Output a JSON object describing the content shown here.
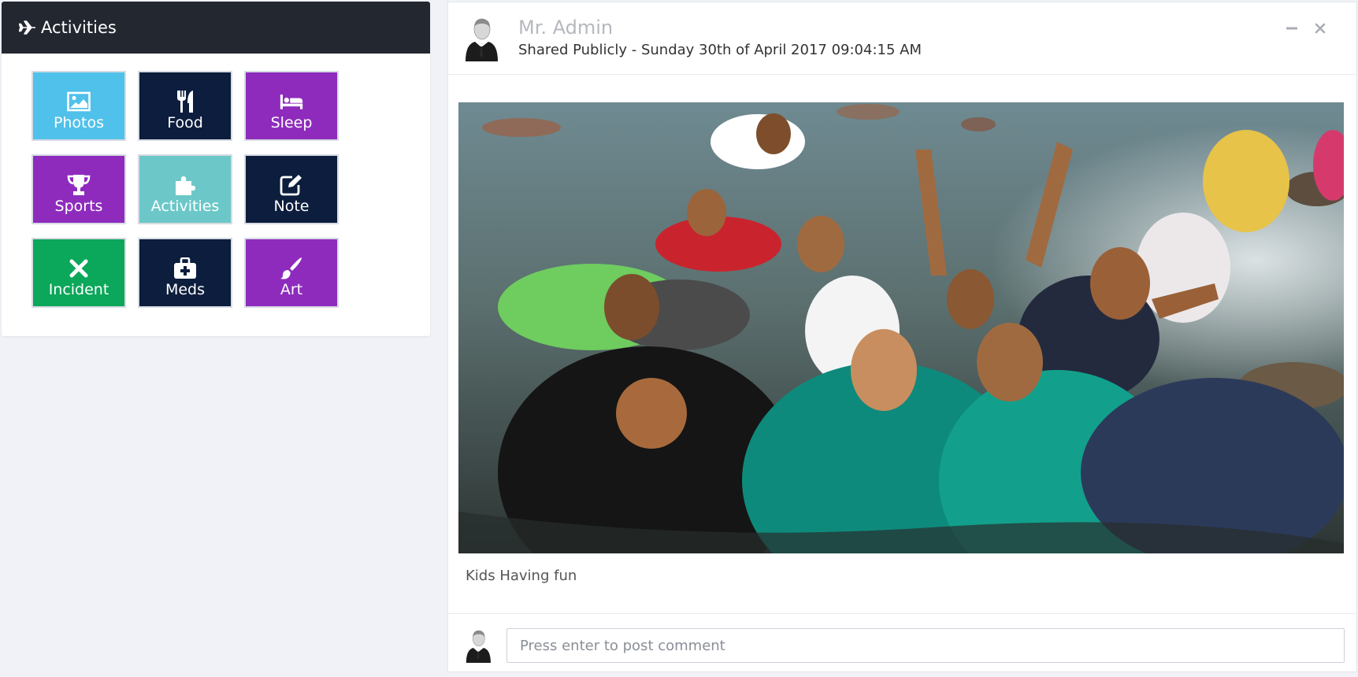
{
  "activities": {
    "title": "Activities",
    "tiles": [
      {
        "label": "Photos",
        "icon": "picture-icon",
        "color": "#4fc1ea"
      },
      {
        "label": "Food",
        "icon": "fork-knife-icon",
        "color": "#0c1d3d"
      },
      {
        "label": "Sleep",
        "icon": "bed-icon",
        "color": "#8e2bbd"
      },
      {
        "label": "Sports",
        "icon": "trophy-icon",
        "color": "#8e2bbd"
      },
      {
        "label": "Activities",
        "icon": "puzzle-icon",
        "color": "#6cc8c8"
      },
      {
        "label": "Note",
        "icon": "edit-icon",
        "color": "#0c1d3d"
      },
      {
        "label": "Incident",
        "icon": "x-icon",
        "color": "#0ba75a"
      },
      {
        "label": "Meds",
        "icon": "medkit-icon",
        "color": "#0c1d3d"
      },
      {
        "label": "Art",
        "icon": "paintbrush-icon",
        "color": "#8e2bbd"
      }
    ]
  },
  "post": {
    "author": "Mr. Admin",
    "shared": "Shared Publicly - Sunday 30th of April 2017 09:04:15 AM",
    "caption": "Kids Having fun",
    "comment_placeholder": "Press enter to post comment"
  }
}
